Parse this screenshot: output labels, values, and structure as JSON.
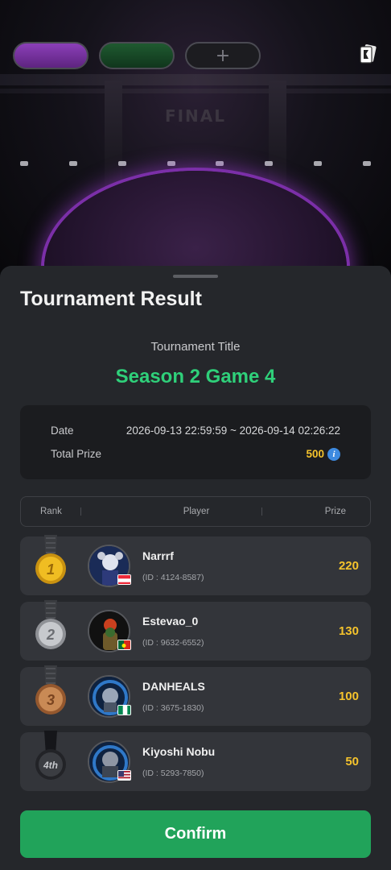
{
  "stage": {
    "sign_text": "FINAL"
  },
  "topbar": {
    "add_label": "+",
    "rules_icon": "card-icon"
  },
  "result": {
    "heading": "Tournament Result",
    "title_label": "Tournament Title",
    "title": "Season 2 Game 4",
    "date_label": "Date",
    "date_value": "2026-09-13 22:59:59 ~ 2026-09-14 02:26:22",
    "prize_label": "Total Prize",
    "prize_value": "500",
    "prize_info_icon": "info-icon"
  },
  "table": {
    "headers": {
      "rank": "Rank",
      "player": "Player",
      "prize": "Prize"
    },
    "rows": [
      {
        "rank": "1",
        "medal": "gold",
        "name": "Narrrf",
        "id": "(ID : 4124-8587)",
        "prize": "220",
        "flag": "austria"
      },
      {
        "rank": "2",
        "medal": "silver",
        "name": "Estevao_0",
        "id": "(ID : 9632-6552)",
        "prize": "130",
        "flag": "portugal"
      },
      {
        "rank": "3",
        "medal": "bronze",
        "name": "DANHEALS",
        "id": "(ID : 3675-1830)",
        "prize": "100",
        "flag": "nigeria"
      },
      {
        "rank": "4th",
        "medal": "dark",
        "name": "Kiyoshi Nobu",
        "id": "(ID : 5293-7850)",
        "prize": "50",
        "flag": "usa"
      }
    ]
  },
  "confirm_label": "Confirm",
  "colors": {
    "accent_green": "#2fd07a",
    "prize_gold": "#f5c32c",
    "button_green": "#21a35a",
    "sheet_bg": "#25272b"
  }
}
